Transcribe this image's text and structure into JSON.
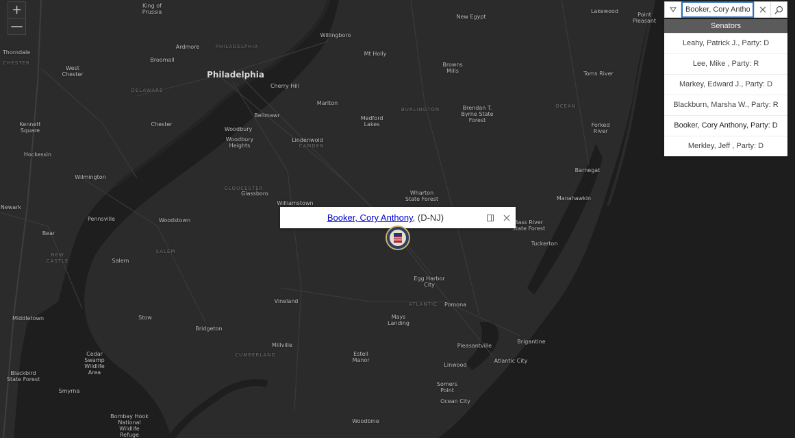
{
  "map": {
    "colors": {
      "land": "#2b2b2b",
      "water": "#1c1c1c",
      "roads": "#3b3b3b",
      "label": "#b9b9b9"
    },
    "labels": [
      {
        "text": "King of\nPrussia",
        "kind": "town"
      },
      {
        "text": "New Egypt",
        "kind": "town"
      },
      {
        "text": "Lakewood",
        "kind": "town"
      },
      {
        "text": "Point\nPleasant",
        "kind": "town"
      },
      {
        "text": "Willingboro",
        "kind": "town"
      },
      {
        "text": "Thorndale",
        "kind": "town"
      },
      {
        "text": "CHESTER",
        "kind": "region"
      },
      {
        "text": "West\nChester",
        "kind": "town"
      },
      {
        "text": "Broomall",
        "kind": "town"
      },
      {
        "text": "Ardmore",
        "kind": "town"
      },
      {
        "text": "PHILADELPHIA",
        "kind": "region"
      },
      {
        "text": "Mt Holly",
        "kind": "town"
      },
      {
        "text": "Browns\nMills",
        "kind": "town"
      },
      {
        "text": "Toms River",
        "kind": "town"
      },
      {
        "text": "Philadelphia",
        "kind": "major"
      },
      {
        "text": "Cherry Hill",
        "kind": "town"
      },
      {
        "text": "DELAWARE",
        "kind": "region"
      },
      {
        "text": "Marlton",
        "kind": "town"
      },
      {
        "text": "Brendan T.\nByrne State\nForest",
        "kind": "town"
      },
      {
        "text": "BURLINGTON",
        "kind": "region"
      },
      {
        "text": "OCEAN",
        "kind": "region"
      },
      {
        "text": "Bellmawr",
        "kind": "town"
      },
      {
        "text": "Medford\nLakes",
        "kind": "town"
      },
      {
        "text": "Kennett\nSquare",
        "kind": "town"
      },
      {
        "text": "Chester",
        "kind": "town"
      },
      {
        "text": "Forked\nRiver",
        "kind": "town"
      },
      {
        "text": "Woodbury",
        "kind": "town"
      },
      {
        "text": "Woodbury\nHeights",
        "kind": "town"
      },
      {
        "text": "Lindenwold",
        "kind": "town"
      },
      {
        "text": "CAMDEN",
        "kind": "region"
      },
      {
        "text": "Hockessin",
        "kind": "town"
      },
      {
        "text": "Barnegat",
        "kind": "town"
      },
      {
        "text": "Wilmington",
        "kind": "town"
      },
      {
        "text": "GLOUCESTER",
        "kind": "region"
      },
      {
        "text": "Glassboro",
        "kind": "town"
      },
      {
        "text": "Wharton\nState Forest",
        "kind": "town"
      },
      {
        "text": "Manahawkin",
        "kind": "town"
      },
      {
        "text": "Williamstown",
        "kind": "town"
      },
      {
        "text": "Newark",
        "kind": "town"
      },
      {
        "text": "Pennsville",
        "kind": "town"
      },
      {
        "text": "Woodstown",
        "kind": "town"
      },
      {
        "text": "Bass River\nState Forest",
        "kind": "town"
      },
      {
        "text": "Bear",
        "kind": "town"
      },
      {
        "text": "Tuckerton",
        "kind": "town"
      },
      {
        "text": "NEW\nCASTLE",
        "kind": "region"
      },
      {
        "text": "SALEM",
        "kind": "region"
      },
      {
        "text": "Salem",
        "kind": "town"
      },
      {
        "text": "Egg Harbor\nCity",
        "kind": "town"
      },
      {
        "text": "Vineland",
        "kind": "town"
      },
      {
        "text": "ATLANTIC",
        "kind": "region"
      },
      {
        "text": "Pomona",
        "kind": "town"
      },
      {
        "text": "Middletown",
        "kind": "town"
      },
      {
        "text": "Stow",
        "kind": "town"
      },
      {
        "text": "Mays\nLanding",
        "kind": "town"
      },
      {
        "text": "Bridgeton",
        "kind": "town"
      },
      {
        "text": "Brigantine",
        "kind": "town"
      },
      {
        "text": "Millville",
        "kind": "town"
      },
      {
        "text": "Pleasantville",
        "kind": "town"
      },
      {
        "text": "Cedar\nSwamp\nWildlife\nArea",
        "kind": "town"
      },
      {
        "text": "Estell\nManor",
        "kind": "town"
      },
      {
        "text": "CUMBERLAND",
        "kind": "region"
      },
      {
        "text": "Atlantic City",
        "kind": "town"
      },
      {
        "text": "Linwood",
        "kind": "town"
      },
      {
        "text": "Blackbird\nState Forest",
        "kind": "town"
      },
      {
        "text": "Somers\nPoint",
        "kind": "town"
      },
      {
        "text": "Smyrna",
        "kind": "town"
      },
      {
        "text": "Ocean City",
        "kind": "town"
      },
      {
        "text": "Bombay Hook\nNational\nWildlife\nRefuge",
        "kind": "town"
      },
      {
        "text": "Woodbine",
        "kind": "town"
      }
    ]
  },
  "zoom": {
    "in_label": "+",
    "out_label": "—"
  },
  "search": {
    "value": "Booker, Cory Anthony",
    "dropdown_icon": "chevron-down-icon",
    "clear_icon": "close-icon",
    "search_icon": "search-icon"
  },
  "results": {
    "header": "Senators",
    "items": [
      "Leahy, Patrick J., Party: D",
      "Lee, Mike , Party: R",
      "Markey, Edward J., Party: D",
      "Blackburn, Marsha W., Party: R",
      "Booker, Cory Anthony, Party: D",
      "Merkley, Jeff , Party: D"
    ]
  },
  "popup": {
    "name_link": "Booker, Cory Anthony",
    "suffix": ", (D-NJ)",
    "dock_icon": "dock-icon",
    "close_icon": "close-icon"
  },
  "marker": {
    "icon": "senate-seal-icon"
  }
}
